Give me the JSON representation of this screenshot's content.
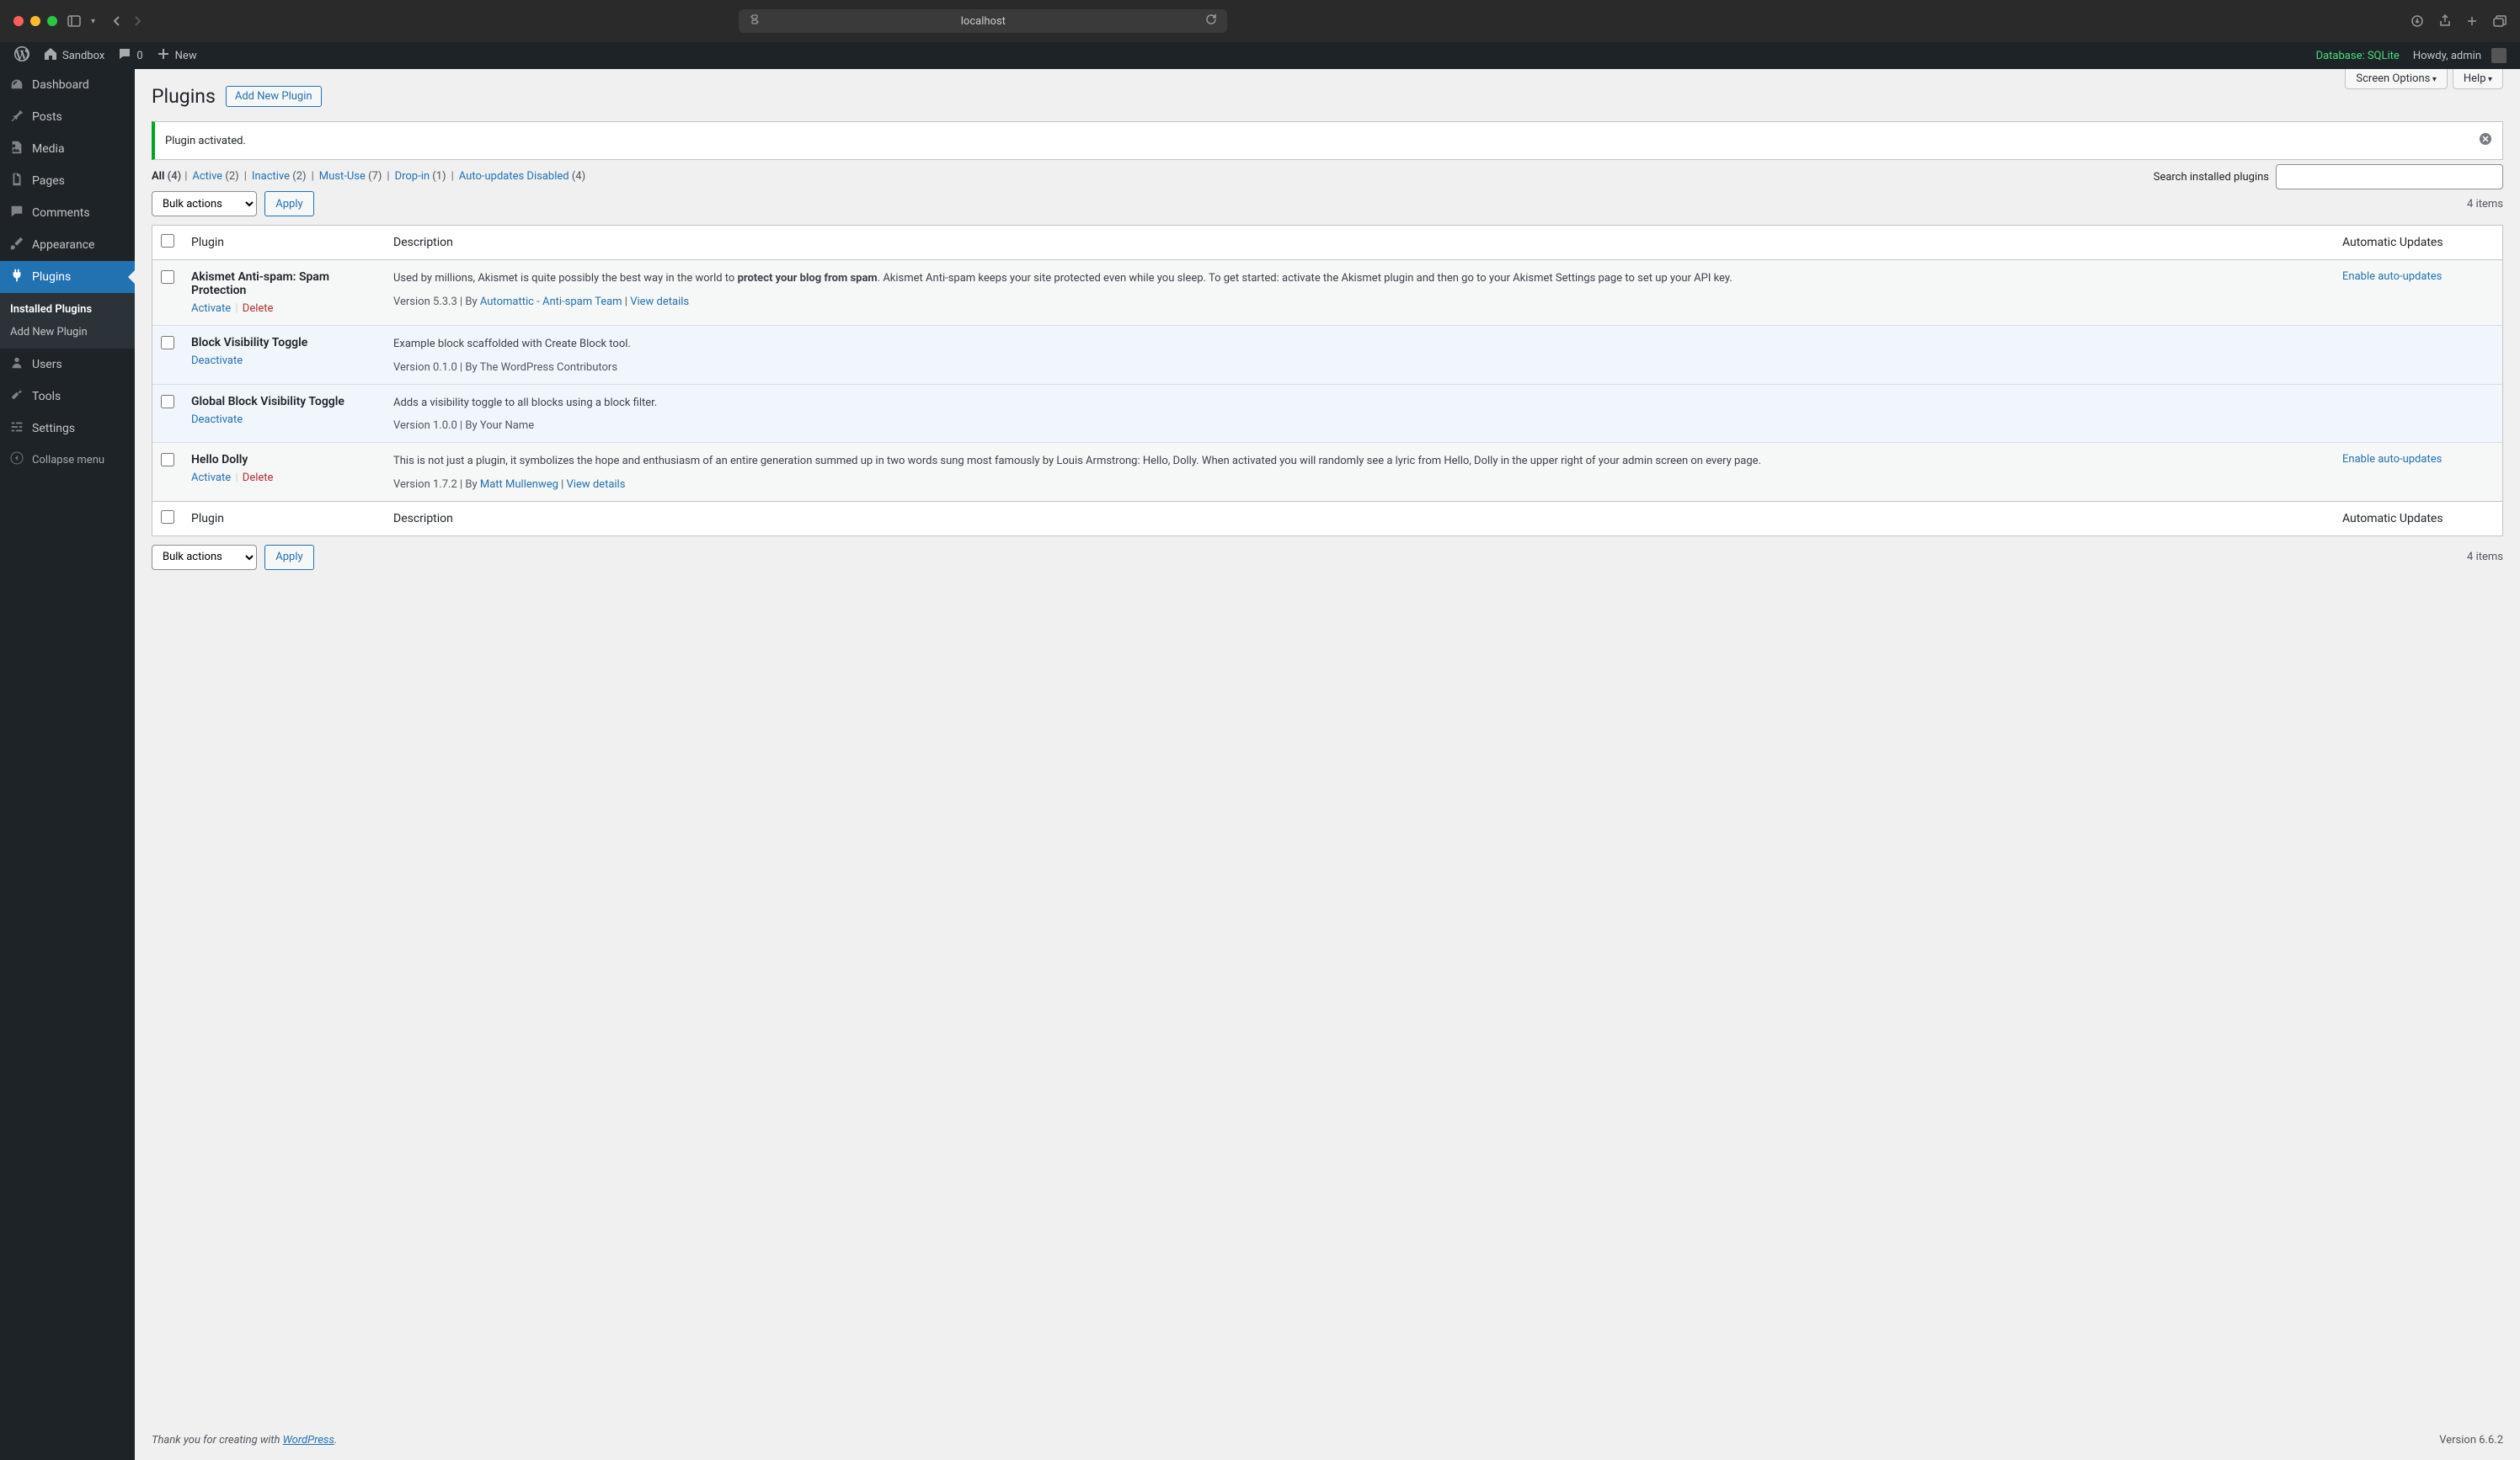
{
  "browser": {
    "url": "localhost"
  },
  "adminbar": {
    "site_name": "Sandbox",
    "comments": "0",
    "new": "New",
    "database": "Database: SQLite",
    "howdy": "Howdy, admin"
  },
  "menu": {
    "dashboard": "Dashboard",
    "posts": "Posts",
    "media": "Media",
    "pages": "Pages",
    "comments": "Comments",
    "appearance": "Appearance",
    "plugins": "Plugins",
    "installed": "Installed Plugins",
    "addnew": "Add New Plugin",
    "users": "Users",
    "tools": "Tools",
    "settings": "Settings",
    "collapse": "Collapse menu"
  },
  "screen": {
    "options": "Screen Options",
    "help": "Help"
  },
  "page": {
    "title": "Plugins",
    "add_new": "Add New Plugin",
    "notice": "Plugin activated."
  },
  "filters": {
    "all_label": "All",
    "all_count": "(4)",
    "active_label": "Active",
    "active_count": "(2)",
    "inactive_label": "Inactive",
    "inactive_count": "(2)",
    "mustuse_label": "Must-Use",
    "mustuse_count": "(7)",
    "dropin_label": "Drop-in",
    "dropin_count": "(1)",
    "auto_label": "Auto-updates Disabled",
    "auto_count": "(4)"
  },
  "search": {
    "label": "Search installed plugins"
  },
  "bulk": {
    "label": "Bulk actions",
    "apply": "Apply"
  },
  "paging": {
    "items": "4 items"
  },
  "table": {
    "col_plugin": "Plugin",
    "col_desc": "Description",
    "col_auto": "Automatic Updates"
  },
  "plugins": {
    "akismet": {
      "name": "Akismet Anti-spam: Spam Protection",
      "desc_1": "Used by millions, Akismet is quite possibly the best way in the world to ",
      "desc_bold": "protect your blog from spam",
      "desc_2": ". Akismet Anti-spam keeps your site protected even while you sleep. To get started: activate the Akismet plugin and then go to your Akismet Settings page to set up your API key.",
      "version_by": "Version 5.3.3 | By ",
      "author": "Automattic - Anti-spam Team",
      "view": "View details",
      "auto": "Enable auto-updates"
    },
    "bvt": {
      "name": "Block Visibility Toggle",
      "desc": "Example block scaffolded with Create Block tool.",
      "meta": "Version 0.1.0 | By The WordPress Contributors"
    },
    "gbvt": {
      "name": "Global Block Visibility Toggle",
      "desc": "Adds a visibility toggle to all blocks using a block filter.",
      "meta": "Version 1.0.0 | By Your Name"
    },
    "hello": {
      "name": "Hello Dolly",
      "desc": "This is not just a plugin, it symbolizes the hope and enthusiasm of an entire generation summed up in two words sung most famously by Louis Armstrong: Hello, Dolly. When activated you will randomly see a lyric from Hello, Dolly in the upper right of your admin screen on every page.",
      "version_by": "Version 1.7.2 | By ",
      "author": "Matt Mullenweg",
      "view": "View details",
      "auto": "Enable auto-updates"
    }
  },
  "actions": {
    "activate": "Activate",
    "deactivate": "Deactivate",
    "delete": "Delete"
  },
  "footer": {
    "thanks": "Thank you for creating with ",
    "wp": "WordPress",
    "period": ".",
    "version": "Version 6.6.2"
  }
}
